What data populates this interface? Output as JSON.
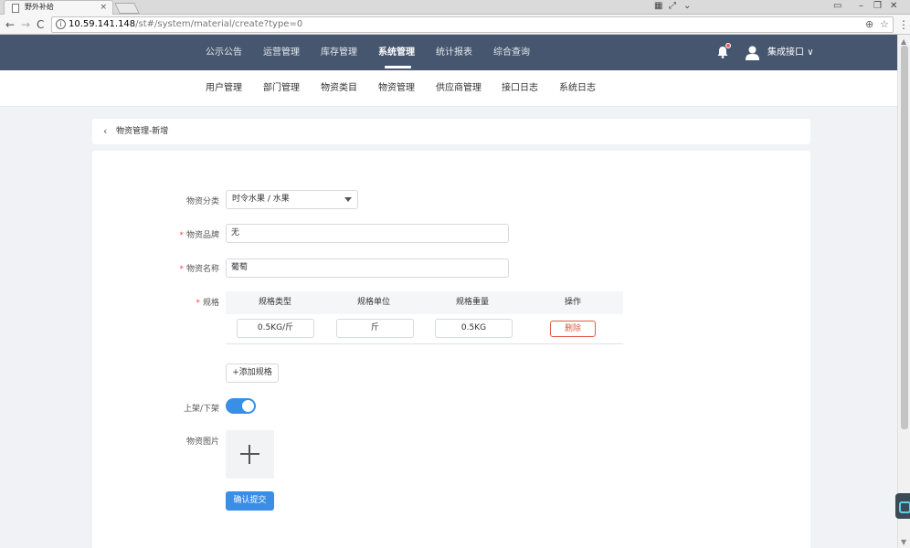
{
  "browser": {
    "tab_title": "野外补给",
    "tab_close": "×",
    "url_host": "10.59.141.148",
    "url_path": "/st#/system/material/create?type=0",
    "back": "←",
    "forward": "→",
    "reload": "C",
    "zoom_glyph": "⊕",
    "star_glyph": "☆",
    "menu_glyph": "⋮"
  },
  "topnav": {
    "items": [
      {
        "label": "公示公告"
      },
      {
        "label": "运营管理"
      },
      {
        "label": "库存管理"
      },
      {
        "label": "系统管理",
        "active": true
      },
      {
        "label": "统计报表"
      },
      {
        "label": "综合查询"
      }
    ],
    "user_name": "集成接口",
    "user_caret": "∨"
  },
  "subnav": {
    "items": [
      {
        "label": "用户管理"
      },
      {
        "label": "部门管理"
      },
      {
        "label": "物资类目"
      },
      {
        "label": "物资管理"
      },
      {
        "label": "供应商管理"
      },
      {
        "label": "接口日志"
      },
      {
        "label": "系统日志"
      }
    ]
  },
  "breadcrumb": {
    "back_glyph": "‹",
    "text": "物资管理-新增"
  },
  "form": {
    "category": {
      "label": "物资分类",
      "value": "时令水果 / 水果"
    },
    "brand": {
      "label": "物资品牌",
      "required": "*",
      "value": "无"
    },
    "name": {
      "label": "物资名称",
      "required": "*",
      "value": "葡萄"
    },
    "spec": {
      "label": "规格",
      "required": "*",
      "headers": [
        "规格类型",
        "规格单位",
        "规格重量",
        "操作"
      ],
      "row": {
        "type": "0.5KG/斤",
        "unit": "斤",
        "weight": "0.5KG",
        "delete_label": "删除"
      },
      "add_label": "+添加规格"
    },
    "shelf": {
      "label": "上架/下架",
      "on": true
    },
    "image": {
      "label": "物资图片"
    },
    "submit_label": "确认提交"
  },
  "colors": {
    "header_bg": "#46566e",
    "primary": "#3a8ee6",
    "danger": "#e05a4a",
    "required": "#f04848"
  }
}
